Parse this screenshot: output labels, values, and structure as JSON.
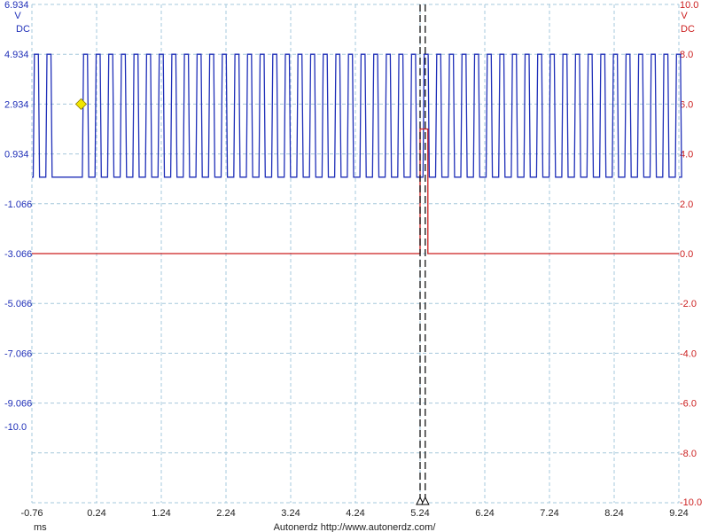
{
  "footer": {
    "x_unit": "ms",
    "credit": "Autonerdz    http://www.autonerdz.com/"
  },
  "colors": {
    "ch1": "#1f2fb8",
    "ch2": "#cc1f1f",
    "grid": "#a6c8dc",
    "cursor": "#000000",
    "marker": "#f2e600"
  },
  "chart_data": {
    "type": "line",
    "title": "",
    "grid": true,
    "xlabel": "ms",
    "x_ticks": [
      "-0.76",
      "0.24",
      "1.24",
      "2.24",
      "3.24",
      "4.24",
      "5.24",
      "6.24",
      "7.24",
      "8.24",
      "9.24"
    ],
    "xlim": [
      -0.76,
      9.24
    ],
    "left_axis": {
      "unit_top": "V",
      "unit_bottom": "DC",
      "ticks": [
        "6.934",
        "4.934",
        "2.934",
        "0.934",
        "-1.066",
        "-3.066",
        "-5.066",
        "-7.066",
        "-9.066",
        "-10.0"
      ],
      "ylim": [
        -13.066,
        6.934
      ]
    },
    "right_axis": {
      "unit_top": "V",
      "unit_bottom": "DC",
      "ticks": [
        "10.0",
        "8.0",
        "6.0",
        "4.0",
        "2.0",
        "0.0",
        "-2.0",
        "-4.0",
        "-6.0",
        "-8.0",
        "-10.0"
      ],
      "ylim": [
        -10.0,
        10.0
      ]
    },
    "series": [
      {
        "axis": "left",
        "shape": "square_wave",
        "high": 4.934,
        "low": 0.0,
        "period_ms": 0.195,
        "gap_ms": [
          -0.36,
          0.0
        ],
        "x_range": [
          -0.76,
          9.24
        ]
      },
      {
        "axis": "right",
        "shape": "pulse",
        "baseline": 0.0,
        "peak": 5.0,
        "pulse_ms": [
          5.24,
          5.36
        ],
        "x_range": [
          -0.76,
          9.24
        ]
      }
    ],
    "cursors_ms": [
      5.24,
      5.32
    ],
    "trigger_marker": {
      "x_ms": 0.0,
      "y_v": 2.934
    }
  }
}
